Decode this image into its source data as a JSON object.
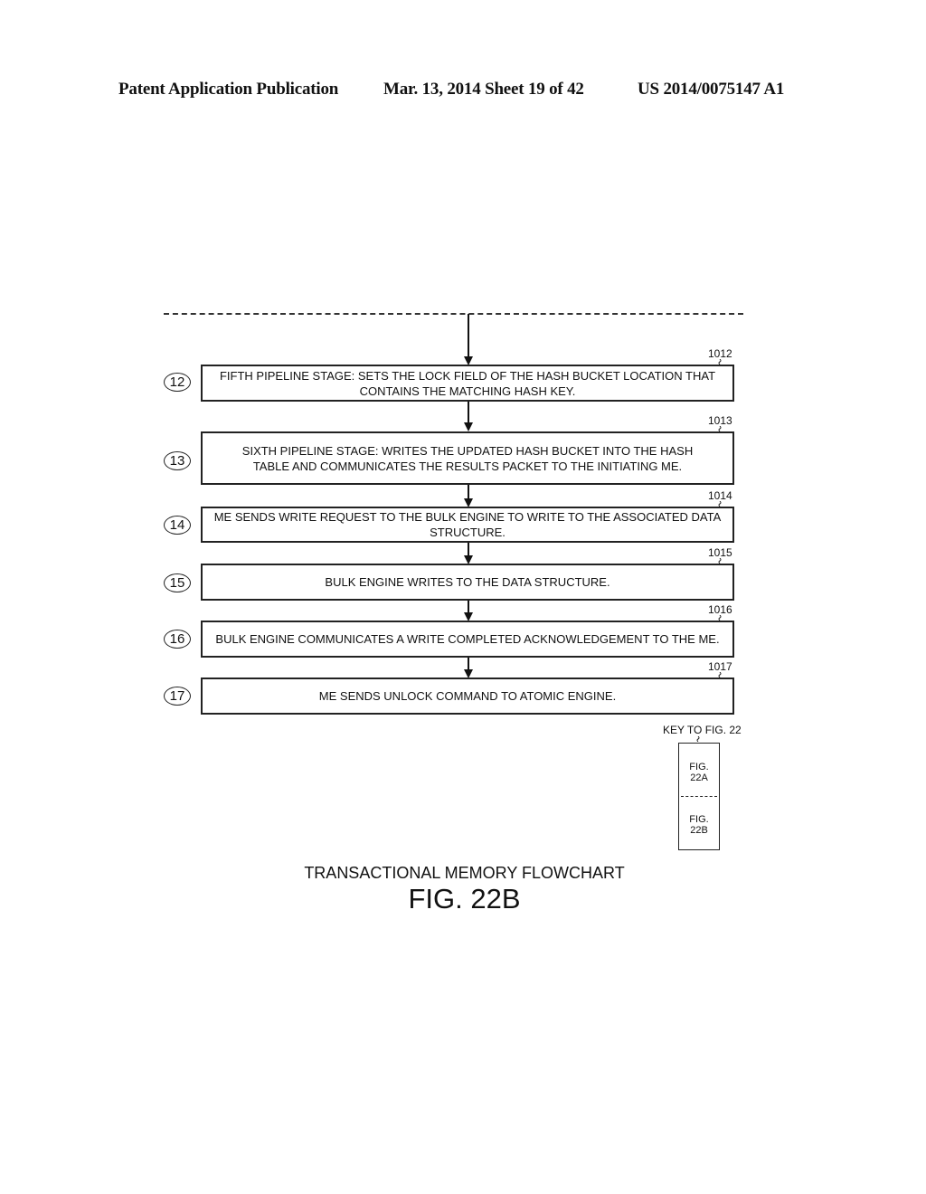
{
  "header": {
    "publication": "Patent Application Publication",
    "date_sheet": "Mar. 13, 2014  Sheet 19 of 42",
    "patent_number": "US 2014/0075147 A1"
  },
  "steps": [
    {
      "number": "12",
      "ref": "1012",
      "text": "FIFTH PIPELINE STAGE: SETS THE LOCK FIELD OF THE HASH BUCKET LOCATION THAT CONTAINS THE MATCHING HASH KEY."
    },
    {
      "number": "13",
      "ref": "1013",
      "text": "SIXTH PIPELINE STAGE: WRITES THE UPDATED HASH BUCKET INTO THE HASH TABLE AND COMMUNICATES THE RESULTS PACKET TO THE INITIATING ME."
    },
    {
      "number": "14",
      "ref": "1014",
      "text": "ME SENDS WRITE REQUEST TO THE BULK ENGINE TO WRITE TO THE ASSOCIATED DATA STRUCTURE."
    },
    {
      "number": "15",
      "ref": "1015",
      "text": "BULK ENGINE WRITES TO THE DATA STRUCTURE."
    },
    {
      "number": "16",
      "ref": "1016",
      "text": "BULK ENGINE COMMUNICATES A WRITE COMPLETED ACKNOWLEDGEMENT TO THE ME."
    },
    {
      "number": "17",
      "ref": "1017",
      "text": "ME SENDS UNLOCK COMMAND TO ATOMIC ENGINE."
    }
  ],
  "key": {
    "label": "KEY TO FIG. 22",
    "top_cell": "FIG.\n22A",
    "bottom_cell": "FIG.\n22B"
  },
  "caption": {
    "title": "TRANSACTIONAL MEMORY FLOWCHART",
    "figure": "FIG. 22B"
  }
}
